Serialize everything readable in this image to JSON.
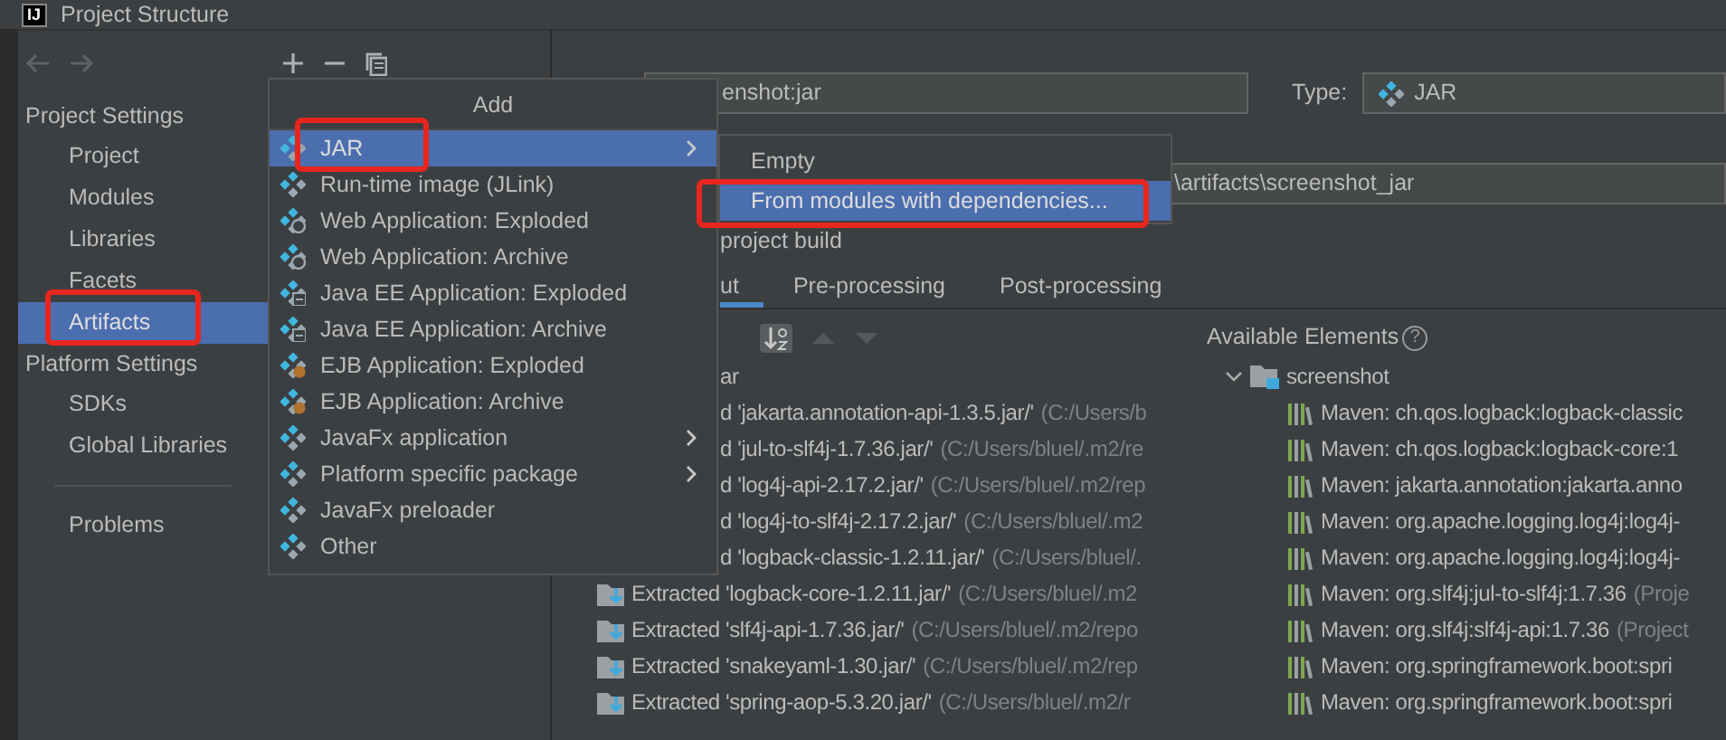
{
  "window": {
    "logo_text": "IJ",
    "title": "Project Structure"
  },
  "sidebar": {
    "sections": [
      {
        "heading": "Project Settings",
        "items": [
          {
            "label": "Project",
            "selected": false
          },
          {
            "label": "Modules",
            "selected": false
          },
          {
            "label": "Libraries",
            "selected": false
          },
          {
            "label": "Facets",
            "selected": false
          },
          {
            "label": "Artifacts",
            "selected": true
          }
        ]
      },
      {
        "heading": "Platform Settings",
        "items": [
          {
            "label": "SDKs",
            "selected": false
          },
          {
            "label": "Global Libraries",
            "selected": false
          }
        ]
      }
    ],
    "footer_items": [
      {
        "label": "Problems",
        "selected": false
      }
    ]
  },
  "add_menu": {
    "title": "Add",
    "items": [
      {
        "label": "JAR",
        "kind": "jar",
        "submenu": true,
        "selected": true
      },
      {
        "label": "Run-time image (JLink)",
        "kind": "jar",
        "submenu": false,
        "selected": false
      },
      {
        "label": "Web Application: Exploded",
        "kind": "web",
        "submenu": false,
        "selected": false
      },
      {
        "label": "Web Application: Archive",
        "kind": "web",
        "submenu": false,
        "selected": false
      },
      {
        "label": "Java EE Application: Exploded",
        "kind": "javaee",
        "submenu": false,
        "selected": false
      },
      {
        "label": "Java EE Application: Archive",
        "kind": "javaee",
        "submenu": false,
        "selected": false
      },
      {
        "label": "EJB Application: Exploded",
        "kind": "ejb",
        "submenu": false,
        "selected": false
      },
      {
        "label": "EJB Application: Archive",
        "kind": "ejb",
        "submenu": false,
        "selected": false
      },
      {
        "label": "JavaFx application",
        "kind": "jar",
        "submenu": true,
        "selected": false
      },
      {
        "label": "Platform specific package",
        "kind": "jar",
        "submenu": true,
        "selected": false
      },
      {
        "label": "JavaFx preloader",
        "kind": "jar",
        "submenu": false,
        "selected": false
      },
      {
        "label": "Other",
        "kind": "jar",
        "submenu": false,
        "selected": false
      }
    ]
  },
  "jar_submenu": {
    "items": [
      {
        "label": "Empty",
        "selected": false
      },
      {
        "label": "From modules with dependencies...",
        "selected": true
      }
    ]
  },
  "name_field": {
    "value": "enshot:jar"
  },
  "type": {
    "label": "Type:",
    "value": "JAR"
  },
  "output_directory": {
    "value": "\\artifacts\\screenshot_jar"
  },
  "build_option": {
    "label": "project build"
  },
  "tabs": [
    {
      "label": "ut",
      "selected": true
    },
    {
      "label": "Pre-processing",
      "selected": false
    },
    {
      "label": "Post-processing",
      "selected": false
    }
  ],
  "output_tree": {
    "root": "ar",
    "rows": [
      {
        "kind": "covered",
        "name": "d 'jakarta.annotation-api-1.3.5.jar/'",
        "path": "(C:/Users/b"
      },
      {
        "kind": "covered",
        "name": "d 'jul-to-slf4j-1.7.36.jar/'",
        "path": "(C:/Users/bluel/.m2/re"
      },
      {
        "kind": "covered",
        "name": "d 'log4j-api-2.17.2.jar/'",
        "path": "(C:/Users/bluel/.m2/rep"
      },
      {
        "kind": "covered",
        "name": "d 'log4j-to-slf4j-2.17.2.jar/'",
        "path": "(C:/Users/bluel/.m2"
      },
      {
        "kind": "covered",
        "name": "d 'logback-classic-1.2.11.jar/'",
        "path": "(C:/Users/bluel/."
      },
      {
        "kind": "extracted",
        "name": "Extracted 'logback-core-1.2.11.jar/'",
        "path": "(C:/Users/bluel/.m2"
      },
      {
        "kind": "extracted",
        "name": "Extracted 'slf4j-api-1.7.36.jar/'",
        "path": "(C:/Users/bluel/.m2/repo"
      },
      {
        "kind": "extracted",
        "name": "Extracted 'snakeyaml-1.30.jar/'",
        "path": "(C:/Users/bluel/.m2/rep"
      },
      {
        "kind": "extracted",
        "name": "Extracted 'spring-aop-5.3.20.jar/'",
        "path": "(C:/Users/bluel/.m2/r"
      }
    ]
  },
  "available_elements": {
    "title": "Available Elements",
    "help": "?",
    "root": {
      "label": "screenshot",
      "expanded": true,
      "children": [
        {
          "label": "Maven: ch.qos.logback:logback-classic"
        },
        {
          "label": "Maven: ch.qos.logback:logback-core:1"
        },
        {
          "label": "Maven: jakarta.annotation:jakarta.anno"
        },
        {
          "label": "Maven: org.apache.logging.log4j:log4j-"
        },
        {
          "label": "Maven: org.apache.logging.log4j:log4j-"
        },
        {
          "label": "Maven: org.slf4j:jul-to-slf4j:1.7.36",
          "note": "(Proje"
        },
        {
          "label": "Maven: org.slf4j:slf4j-api:1.7.36",
          "note": "(Project"
        },
        {
          "label": "Maven: org.springframework.boot:spri"
        },
        {
          "label": "Maven: org.springframework.boot:spri"
        }
      ]
    }
  }
}
